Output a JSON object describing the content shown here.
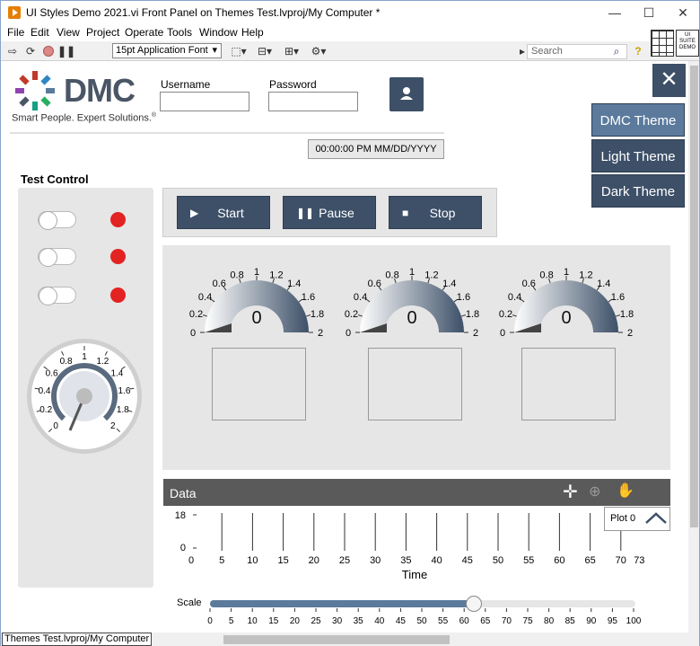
{
  "window": {
    "title": "UI Styles Demo 2021.vi Front Panel on Themes Test.lvproj/My Computer *",
    "controls": [
      "—",
      "☐",
      "✕"
    ]
  },
  "menu": [
    "File",
    "Edit",
    "View",
    "Project",
    "Operate",
    "Tools",
    "Window",
    "Help"
  ],
  "toolbar": {
    "font": "15pt Application Font",
    "search_placeholder": "Search",
    "help_glyph": "?"
  },
  "suite_badge": [
    "UI",
    "SUITE",
    "DEMO"
  ],
  "logo": {
    "text": "DMC",
    "tagline": "Smart People. Expert Solutions.",
    "registered": "®"
  },
  "login": {
    "username_label": "Username",
    "username_value": "",
    "password_label": "Password",
    "password_value": ""
  },
  "datetime": "00:00:00 PM MM/DD/YYYY",
  "close_label": "✕",
  "themes": [
    {
      "label": "DMC Theme",
      "color": "#5b7a9c"
    },
    {
      "label": "Light Theme",
      "color": "#3d5068"
    },
    {
      "label": "Dark Theme",
      "color": "#3d5068"
    }
  ],
  "test_control": {
    "title": "Test Control",
    "toggles": [
      false,
      false,
      false
    ],
    "leds": [
      "#e32222",
      "#e32222",
      "#e32222"
    ],
    "dial": {
      "ticks": [
        "0",
        "0.2",
        "0.4",
        "0.6",
        "0.8",
        "1",
        "1.2",
        "1.4",
        "1.6",
        "1.8",
        "2"
      ],
      "value": 0
    }
  },
  "controls": [
    {
      "label": "Start",
      "icon": "▶"
    },
    {
      "label": "Pause",
      "icon": "❚❚"
    },
    {
      "label": "Stop",
      "icon": "■"
    }
  ],
  "gauges": [
    {
      "value": "0",
      "ticks": [
        "0",
        "0.2",
        "0.4",
        "0.6",
        "0.8",
        "1",
        "1.2",
        "1.4",
        "1.6",
        "1.8",
        "2"
      ]
    },
    {
      "value": "0",
      "ticks": [
        "0",
        "0.2",
        "0.4",
        "0.6",
        "0.8",
        "1",
        "1.2",
        "1.4",
        "1.6",
        "1.8",
        "2"
      ]
    },
    {
      "value": "0",
      "ticks": [
        "0",
        "0.2",
        "0.4",
        "0.6",
        "0.8",
        "1",
        "1.2",
        "1.4",
        "1.6",
        "1.8",
        "2"
      ]
    }
  ],
  "data": {
    "title": "Data",
    "legend": "Plot 0",
    "x_label": "Time",
    "x_ticks": [
      "0",
      "5",
      "10",
      "15",
      "20",
      "25",
      "30",
      "35",
      "40",
      "45",
      "50",
      "55",
      "60",
      "65",
      "70",
      "73"
    ],
    "y_ticks": [
      "18",
      "0"
    ]
  },
  "scale": {
    "label": "Scale",
    "ticks": [
      "0",
      "5",
      "10",
      "15",
      "20",
      "25",
      "30",
      "35",
      "40",
      "45",
      "50",
      "55",
      "60",
      "65",
      "70",
      "75",
      "80",
      "85",
      "90",
      "95",
      "100"
    ],
    "value": 62
  },
  "status": "Themes Test.lvproj/My Computer",
  "colors": {
    "accent": "#3d5068",
    "accent_light": "#5b7a9c",
    "panel": "#e6e6e6",
    "led_red": "#e32222"
  }
}
